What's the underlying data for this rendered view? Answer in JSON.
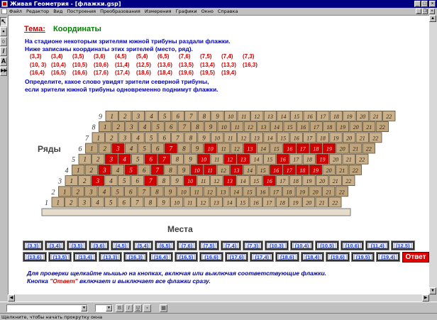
{
  "window": {
    "title": "Живая Геометрия - [флажки.gsp]"
  },
  "menu": {
    "items": [
      "Файл",
      "Редактор",
      "Вид",
      "Построения",
      "Преобразования",
      "Измерения",
      "Графики",
      "Окно",
      "Справка"
    ]
  },
  "tools": [
    {
      "name": "arrow-tool-icon",
      "glyph": "↖"
    },
    {
      "name": "point-tool-icon",
      "glyph": "•"
    },
    {
      "name": "compass-tool-icon",
      "glyph": "○"
    },
    {
      "name": "line-tool-icon",
      "glyph": "/"
    },
    {
      "name": "text-tool-icon",
      "glyph": "A"
    },
    {
      "name": "custom-tool-icon",
      "glyph": "▶▶"
    }
  ],
  "doc": {
    "topic_label": "Тема:",
    "topic_value": "Координаты",
    "line1": "На стадионе некоторым зрителям южной трибуны раздали флажки.",
    "line2": "Ниже записаны координаты этих зрителей (место, ряд).",
    "coords": [
      [
        "(3,3)",
        "(3,4)",
        "(3,5)",
        "(3,6)",
        "(4,5)",
        "(5,4)",
        "(6,5)",
        "(7,6)",
        "(7,5)",
        "(7,4)",
        "(7,3)"
      ],
      [
        "(10, 3)",
        "(10,4)",
        "(10,5)",
        "(10,6)",
        "(11,4)",
        "(12,5)",
        "(13,6)",
        "(13,5)",
        "(13,4)",
        "(13,3)",
        "(16,3)"
      ],
      [
        "(16,4)",
        "(16,5)",
        "(16,6)",
        "(17,6)",
        "(17,4)",
        "(18,6)",
        "(18,4)",
        "(19,6)",
        "(19,5)",
        "(19,4)"
      ]
    ],
    "question1": "Определите, какое слово увидят зрители северной трибуны,",
    "question2": "если зрители южной трибуны одновременно поднимут флажки.",
    "rows_label": "Ряды",
    "seats_label": "Места",
    "row_numbers": [
      "1",
      "2",
      "3",
      "4",
      "5",
      "6",
      "7",
      "8",
      "9"
    ],
    "seats_per_row": 22,
    "flags": [
      [
        3,
        3
      ],
      [
        3,
        4
      ],
      [
        3,
        5
      ],
      [
        3,
        6
      ],
      [
        4,
        5
      ],
      [
        5,
        4
      ],
      [
        6,
        5
      ],
      [
        7,
        6
      ],
      [
        7,
        5
      ],
      [
        7,
        4
      ],
      [
        7,
        3
      ],
      [
        10,
        3
      ],
      [
        10,
        4
      ],
      [
        10,
        5
      ],
      [
        10,
        6
      ],
      [
        11,
        4
      ],
      [
        12,
        5
      ],
      [
        13,
        6
      ],
      [
        13,
        5
      ],
      [
        13,
        4
      ],
      [
        13,
        3
      ],
      [
        16,
        3
      ],
      [
        16,
        4
      ],
      [
        16,
        5
      ],
      [
        16,
        6
      ],
      [
        17,
        6
      ],
      [
        17,
        4
      ],
      [
        18,
        6
      ],
      [
        18,
        4
      ],
      [
        19,
        6
      ],
      [
        19,
        5
      ],
      [
        19,
        4
      ]
    ],
    "buttons_row1": [
      "(3,3)",
      "(3,4)",
      "(3,5)",
      "(3,6)",
      "(4,5)",
      "(5,4)",
      "(6,5)",
      "(7,6)",
      "(7,5)",
      "(7,4)",
      "(7,3)",
      "(10,3)",
      "(10,4)",
      "(10,5)",
      "(10,6)",
      "(11,4)",
      "(12,5)"
    ],
    "buttons_row2": [
      "(13,6)",
      "(13,5)",
      "(13,4)",
      "(13,3)",
      "(16,3)",
      "(16,4)",
      "(16,5)",
      "(16,6)",
      "(17,6)",
      "(17,4)",
      "(18,6)",
      "(18,4)",
      "(19,6)",
      "(19,5)",
      "(19,4)"
    ],
    "answer_label": "Ответ",
    "instr1": "Для проверки щелкайте мышью на кнопках, включая или выключая соответствующие флажки.",
    "instr2_a": "Кнопка ",
    "instr2_b": "\"Ответ\"",
    "instr2_c": " включает и выключает все флажки сразу."
  },
  "status": {
    "text": "Щелкните, чтобы начать прокрутку окна"
  },
  "colors": {
    "flag_red": "#d00000",
    "seat_tan": "#c9b08a",
    "title_blue": "#000080"
  }
}
